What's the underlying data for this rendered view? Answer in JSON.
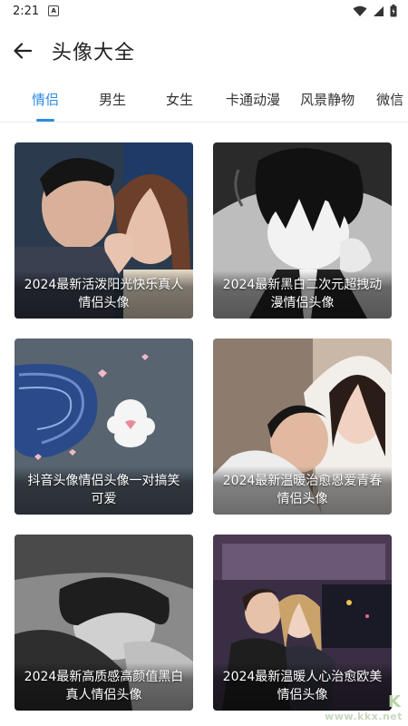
{
  "status_bar": {
    "time": "2:21",
    "notif_label": "A"
  },
  "header": {
    "title": "头像大全"
  },
  "tabs": [
    {
      "label": "情侣",
      "active": true
    },
    {
      "label": "男生",
      "active": false
    },
    {
      "label": "女生",
      "active": false
    },
    {
      "label": "卡通动漫",
      "active": false
    },
    {
      "label": "风景静物",
      "active": false
    },
    {
      "label": "微信",
      "active": false
    }
  ],
  "cards": [
    {
      "caption": "2024最新活泼阳光快乐真人情侣头像"
    },
    {
      "caption": "2024最新黑白二次元超拽动漫情侣头像"
    },
    {
      "caption": "抖音头像情侣头像一对搞笑可爱"
    },
    {
      "caption": "2024最新温暖治愈恩爱青春情侣头像"
    },
    {
      "caption": "2024最新高质感高颜值黑白真人情侣头像"
    },
    {
      "caption": "2024最新温暖人心治愈欧美情侣头像"
    }
  ],
  "watermark": {
    "text": "www.kkx.net",
    "logo": "K"
  },
  "colors": {
    "accent": "#2e8be6"
  }
}
